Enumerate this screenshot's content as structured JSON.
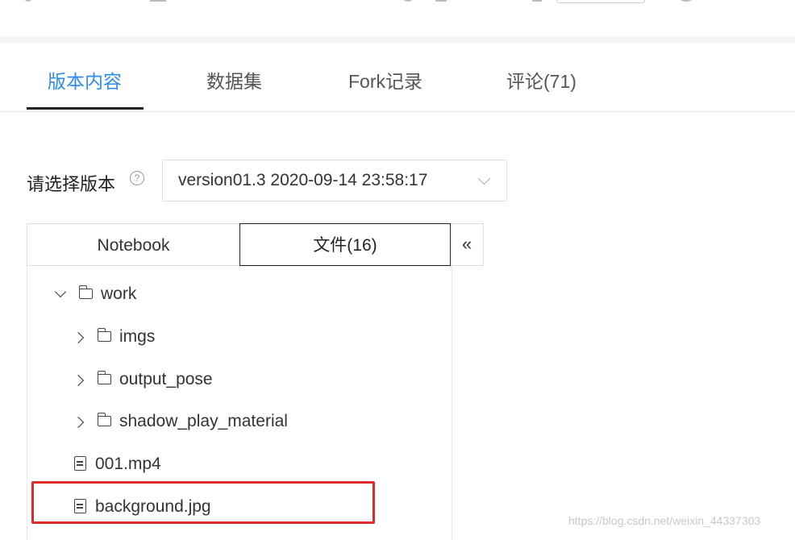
{
  "tabs": [
    {
      "label": "版本内容",
      "active": true
    },
    {
      "label": "数据集",
      "active": false
    },
    {
      "label": "Fork记录",
      "active": false
    },
    {
      "label": "评论(71)",
      "active": false
    }
  ],
  "version": {
    "label": "请选择版本",
    "help_icon": "?",
    "selected": "version01.3 2020-09-14 23:58:17"
  },
  "subtabs": {
    "notebook": "Notebook",
    "files": "文件(16)",
    "collapse": "«"
  },
  "tree": [
    {
      "label": "work",
      "type": "folder",
      "expanded": true
    },
    {
      "label": "imgs",
      "type": "folder",
      "expanded": false
    },
    {
      "label": "output_pose",
      "type": "folder",
      "expanded": false
    },
    {
      "label": "shadow_play_material",
      "type": "folder",
      "expanded": false
    },
    {
      "label": "001.mp4",
      "type": "file"
    },
    {
      "label": "background.jpg",
      "type": "file",
      "highlighted": true
    }
  ],
  "watermark": "https://blog.csdn.net/weixin_44337303",
  "colors": {
    "accent": "#2d8cf0",
    "highlight": "#e02b2b"
  }
}
